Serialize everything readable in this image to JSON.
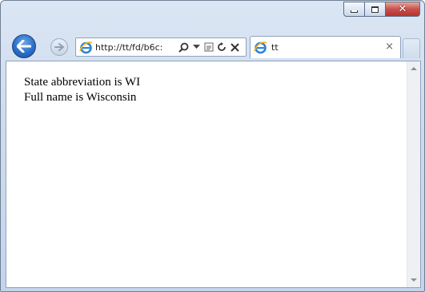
{
  "browser": {
    "address_url": "http://tt/fd/b6c:",
    "tab_title": "tt",
    "tab_close_glyph": "×",
    "icons": [
      "back-arrow-icon",
      "forward-arrow-icon",
      "ie-logo-icon",
      "search-icon",
      "dropdown-icon",
      "compatibility-view-icon",
      "refresh-icon",
      "stop-icon",
      "close-icon"
    ]
  },
  "page": {
    "line1": "State abbreviation is WI",
    "line2": "Full name is Wisconsin"
  },
  "colors": {
    "frame": "#cfdcee",
    "back_button": "#2a6fc9",
    "close_button": "#c75050"
  }
}
